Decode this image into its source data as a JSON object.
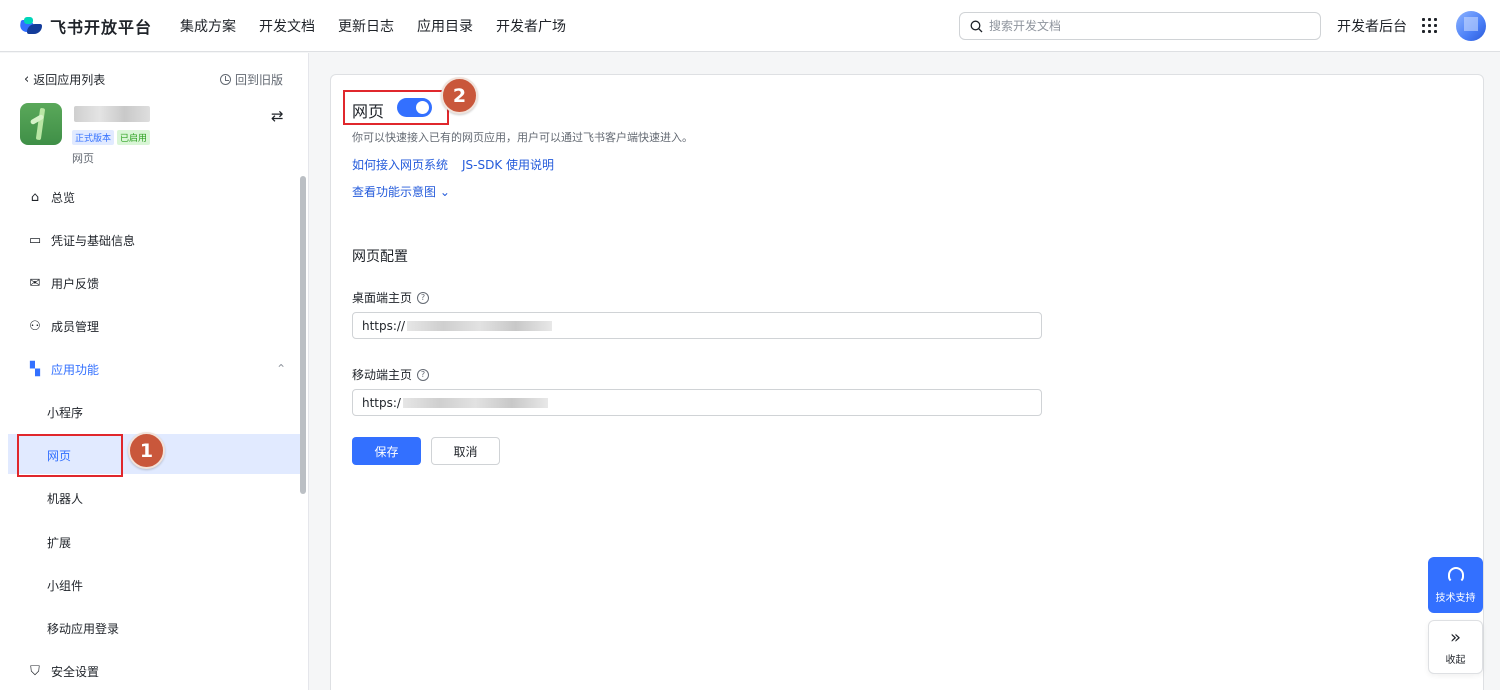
{
  "header": {
    "logo_text": "飞书开放平台",
    "nav": [
      "集成方案",
      "开发文档",
      "更新日志",
      "应用目录",
      "开发者广场"
    ],
    "search_placeholder": "搜索开发文档",
    "dev_console": "开发者后台"
  },
  "sidebar": {
    "back_label": "返回应用列表",
    "old_version": "回到旧版",
    "app": {
      "badge_version": "正式版本",
      "badge_status": "已启用",
      "type": "网页"
    },
    "menu": [
      {
        "label": "总览",
        "icon": "home-icon"
      },
      {
        "label": "凭证与基础信息",
        "icon": "credential-icon"
      },
      {
        "label": "用户反馈",
        "icon": "inbox-icon"
      },
      {
        "label": "成员管理",
        "icon": "person-icon"
      },
      {
        "label": "应用功能",
        "icon": "apps-icon"
      }
    ],
    "sub_menu": [
      "小程序",
      "网页",
      "机器人",
      "扩展",
      "小组件",
      "移动应用登录"
    ],
    "security": "安全设置"
  },
  "annotations": {
    "step1": "1",
    "step2": "2"
  },
  "main": {
    "title": "网页",
    "toggle_on": true,
    "description": "你可以快速接入已有的网页应用，用户可以通过飞书客户端快速进入。",
    "link_howto": "如何接入网页系统",
    "link_jssdk": "JS-SDK 使用说明",
    "link_preview": "查看功能示意图",
    "section_title": "网页配置",
    "desktop_label": "桌面端主页",
    "desktop_value": "https://",
    "mobile_label": "移动端主页",
    "mobile_value": "https:/",
    "save": "保存",
    "cancel": "取消"
  },
  "floating": {
    "support": "技术支持",
    "collapse": "收起"
  },
  "colors": {
    "accent": "#3370ff",
    "highlight": "#e0272c",
    "step_badge": "#c9573b"
  }
}
